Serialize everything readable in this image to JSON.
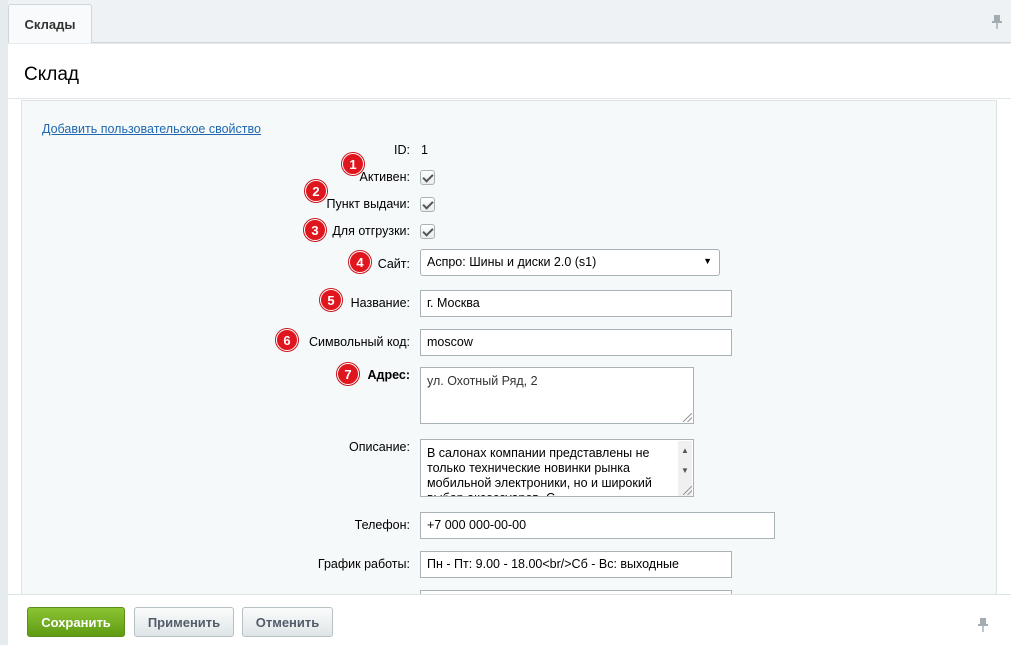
{
  "tabs": [
    {
      "label": "Склады"
    }
  ],
  "page_title": "Склад",
  "add_property_link": "Добавить пользовательское свойство",
  "fields": {
    "id": {
      "label": "ID:",
      "value": "1"
    },
    "active": {
      "label": "Активен:",
      "checked": true,
      "marker": "1"
    },
    "pickup_point": {
      "label": "Пункт выдачи:",
      "checked": true,
      "marker": "2"
    },
    "shipping": {
      "label": "Для отгрузки:",
      "checked": true,
      "marker": "3"
    },
    "site": {
      "label": "Сайт:",
      "value": "Аспро: Шины и диски 2.0 (s1)",
      "marker": "4"
    },
    "name": {
      "label": "Название:",
      "value": "г. Москва",
      "marker": "5"
    },
    "code": {
      "label": "Символьный код:",
      "value": "moscow",
      "marker": "6"
    },
    "address": {
      "label": "Адрес:",
      "value": "ул. Охотный Ряд, 2",
      "marker": "7"
    },
    "description": {
      "label": "Описание:",
      "value": "В салонах компании представлены не только технические новинки рынка мобильной электроники, но и широкий выбор аксессуаров. С"
    },
    "phone": {
      "label": "Телефон:",
      "value": "+7 000 000-00-00"
    },
    "schedule": {
      "label": "График работы:",
      "value": "Пн - Пт: 9.00 - 18.00<br/>Сб - Вс: выходные"
    }
  },
  "buttons": {
    "save": "Сохранить",
    "apply": "Применить",
    "cancel": "Отменить"
  },
  "colors": {
    "marker": "#e0161f",
    "save_button": "#6fab1c",
    "link": "#2067b0"
  }
}
